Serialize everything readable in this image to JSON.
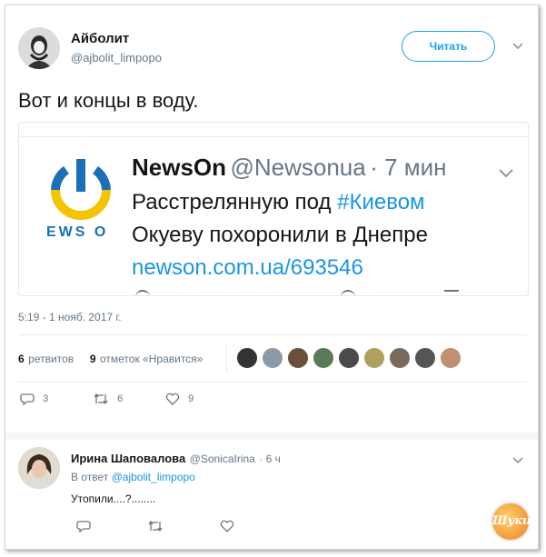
{
  "tweet": {
    "author_name": "Айболит",
    "author_handle": "@ajbolit_limpopo",
    "follow_label": "Читать",
    "text": "Вот и концы в воду.",
    "timestamp": "5:19 - 1 нояб. 2017 г.",
    "retweets_count": "6",
    "retweets_label": "ретвитов",
    "likes_count": "9",
    "likes_label": "отметок «Нравится»",
    "actions": {
      "replies": "3",
      "retweets": "6",
      "likes": "9"
    }
  },
  "embedded": {
    "logo_text": "EWS O",
    "name": "NewsOn",
    "handle": "@Newsonua",
    "time": "· 7 мин",
    "line1_plain": "Расстрелянную под",
    "line1_hashtag": "#Киевом",
    "line2": "Окуеву похоронили в Днепре",
    "link": "newson.com.ua/693546"
  },
  "reply": {
    "author_name": "Ирина Шаповалова",
    "author_handle": "@SonicaIrina",
    "time": "· 6 ч",
    "in_reply_prefix": "В ответ",
    "in_reply_handle": "@ajbolit_limpopo",
    "text": "Утопили....?........"
  },
  "watermark": "Шуки",
  "colors": {
    "accent": "#1da1f2",
    "link": "#1b95e0",
    "secondary": "#657786",
    "logo_yellow": "#f5c400",
    "logo_blue": "#1a6fb8"
  }
}
